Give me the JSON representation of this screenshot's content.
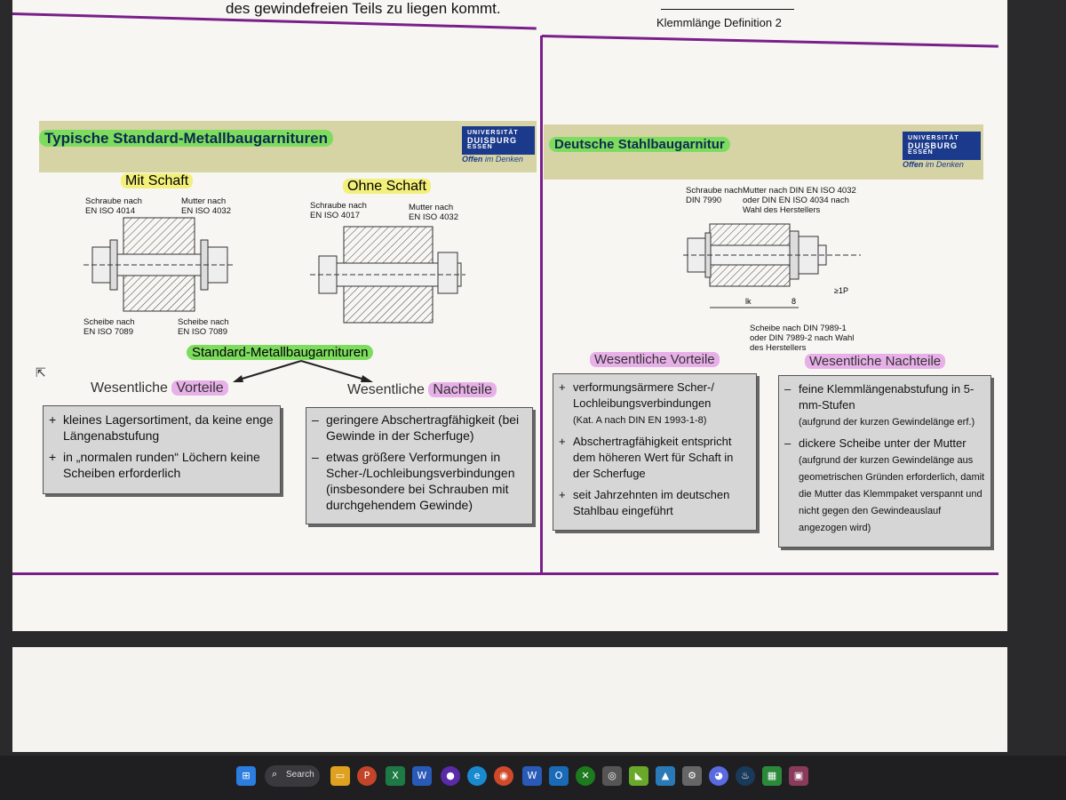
{
  "top_text": {
    "left": "des gewindefreien Teils zu liegen kommt.",
    "right": "Klemmlänge Definition 2"
  },
  "left_slide": {
    "title": "Typische Standard-Metallbaugarnituren",
    "logo": {
      "line1": "UNIVERSITÄT",
      "line2": "DUISBURG",
      "line3": "ESSEN",
      "tagline_bold": "Offen",
      "tagline_rest": " im Denken"
    },
    "mit_schaft": {
      "heading": "Mit Schaft",
      "label_screw": "Schraube nach\nEN ISO 4014",
      "label_nut": "Mutter nach\nEN ISO 4032",
      "label_washer_left": "Scheibe nach\nEN ISO 7089",
      "label_washer_right": "Scheibe nach\nEN ISO 7089"
    },
    "ohne_schaft": {
      "heading": "Ohne Schaft",
      "label_screw": "Schraube nach\nEN ISO 4017",
      "label_nut": "Mutter nach\nEN ISO 4032"
    },
    "center_label": "Standard-Metallbaugarnituren",
    "vorteile_prefix": "Wesentliche ",
    "vorteile_word": "Vorteile",
    "nachteile_prefix": "Wesentliche ",
    "nachteile_word": "Nachteile",
    "vorteile": [
      {
        "sym": "+",
        "text": "kleines Lagersortiment, da keine enge Längenabstufung"
      },
      {
        "sym": "+",
        "text": "in „normalen runden“ Löchern keine Scheiben erforderlich"
      }
    ],
    "nachteile": [
      {
        "sym": "–",
        "text": "geringere Abschertragfähigkeit (bei Gewinde in der Scherfuge)"
      },
      {
        "sym": "–",
        "text": "etwas größere Verformungen in Scher-/Lochleibungsverbindungen (insbesondere bei Schrauben mit durchgehendem Gewinde)"
      }
    ]
  },
  "right_slide": {
    "title": "Deutsche Stahlbaugarnitur",
    "logo": {
      "line1": "UNIVERSITÄT",
      "line2": "DUISBURG",
      "line3": "ESSEN",
      "tagline_bold": "Offen",
      "tagline_rest": " im Denken"
    },
    "label_screw": "Schraube nach\nDIN 7990",
    "label_nut": "Mutter nach DIN EN ISO 4032\noder DIN EN ISO 4034 nach\nWahl des Herstellers",
    "label_washer": "Scheibe nach DIN 7989-1\noder DIN 7989-2 nach Wahl\ndes Herstellers",
    "dim_lk": "lk",
    "dim_8": "8",
    "dim_p": "≥1P",
    "vorteile_label": "Wesentliche Vorteile",
    "nachteile_label": "Wesentliche Nachteile",
    "vorteile": [
      {
        "sym": "+",
        "text": "verformungsärmere Scher-/ Lochleibungsverbindungen",
        "note": "(Kat. A nach DIN EN 1993-1-8)"
      },
      {
        "sym": "+",
        "text": "Abschertragfähigkeit entspricht dem höheren Wert für Schaft in der Scherfuge",
        "note": ""
      },
      {
        "sym": "+",
        "text": "seit Jahrzehnten im deutschen Stahlbau eingeführt",
        "note": ""
      }
    ],
    "nachteile": [
      {
        "sym": "–",
        "text": "feine Klemmlängenabstufung in 5-mm-Stufen",
        "note": "(aufgrund der kurzen Gewindelänge erf.)"
      },
      {
        "sym": "–",
        "text": "dickere Scheibe unter der Mutter",
        "note": "(aufgrund der kurzen Gewindelänge aus geometrischen Gründen erforderlich, damit die Mutter das Klemmpaket verspannt und nicht gegen den Gewindeauslauf angezogen wird)"
      }
    ]
  },
  "taskbar": {
    "search_label": "Search",
    "icons": [
      "windows-start-icon",
      "search-icon",
      "file-explorer-icon",
      "powerpoint-icon",
      "excel-icon",
      "word-icon",
      "app-icon",
      "edge-icon",
      "chrome-icon",
      "word2-icon",
      "outlook-icon",
      "xbox-icon",
      "camera-icon",
      "nvidia-icon",
      "photos-icon",
      "settings-icon",
      "discord-icon",
      "steam-icon",
      "app2-icon",
      "app3-icon"
    ]
  }
}
